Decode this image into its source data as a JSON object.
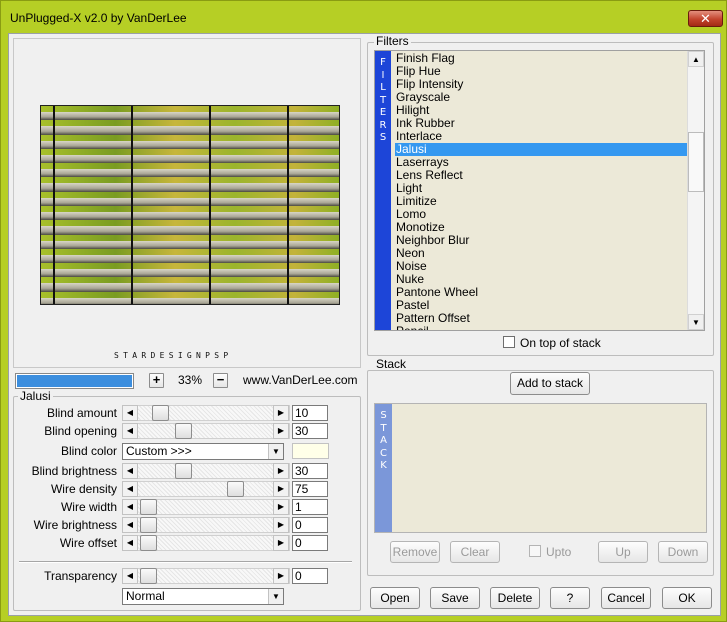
{
  "window": {
    "title": "UnPlugged-X v2.0 by VanDerLee",
    "close_glyph": "✕"
  },
  "preview": {
    "logo_text": "STARDESIGNPSP"
  },
  "zoom": {
    "progress": 1.0,
    "minus": "−",
    "plus": "+",
    "value": "33%",
    "site": "www.VanDerLee.com"
  },
  "jalusi": {
    "label": "Jalusi",
    "rows": [
      {
        "label": "Blind amount",
        "value": "10",
        "fraction": 0.1
      },
      {
        "label": "Blind opening",
        "value": "30",
        "fraction": 0.3
      },
      {
        "label": "Blind color",
        "combo": "Custom >>>",
        "swatch": "#ffffe8"
      },
      {
        "label": "Blind brightness",
        "value": "30",
        "fraction": 0.3
      },
      {
        "label": "Wire density",
        "value": "75",
        "fraction": 0.75
      },
      {
        "label": "Wire width",
        "value": "1",
        "fraction": 0.0
      },
      {
        "label": "Wire brightness",
        "value": "0",
        "fraction": 0.0
      },
      {
        "label": "Wire offset",
        "value": "0",
        "fraction": 0.0
      }
    ],
    "transparency": {
      "label": "Transparency",
      "value": "0",
      "fraction": 0.0
    },
    "blend_mode": "Normal"
  },
  "filters": {
    "label": "Filters",
    "side_letters": "FILTERS",
    "items": [
      "Finish Flag",
      "Flip Hue",
      "Flip Intensity",
      "Grayscale",
      "Hilight",
      "Ink Rubber",
      "Interlace",
      "Jalusi",
      "Laserrays",
      "Lens Reflect",
      "Light",
      "Limitize",
      "Lomo",
      "Monotize",
      "Neighbor Blur",
      "Neon",
      "Noise",
      "Nuke",
      "Pantone Wheel",
      "Pastel",
      "Pattern Offset",
      "Pencil"
    ],
    "selected_index": 7,
    "on_top_label": "On top of stack"
  },
  "stack": {
    "label": "Stack",
    "side_letters": "STACK",
    "add_button": "Add to stack",
    "remove_button": "Remove",
    "clear_button": "Clear",
    "upto_label": "Upto",
    "up_button": "Up",
    "down_button": "Down"
  },
  "footer": {
    "open": "Open",
    "save": "Save",
    "delete": "Delete",
    "help": "?",
    "cancel": "Cancel",
    "ok": "OK"
  },
  "icons": {
    "arrow_left": "◀",
    "arrow_right": "▶",
    "arrow_down": "▼",
    "arrow_up": "▲"
  },
  "colors": {
    "accent_blue": "#3498f0",
    "filter_bar": "#1d45d8",
    "stack_bar": "#7b97d9",
    "window_frame": "#b6cf25"
  }
}
